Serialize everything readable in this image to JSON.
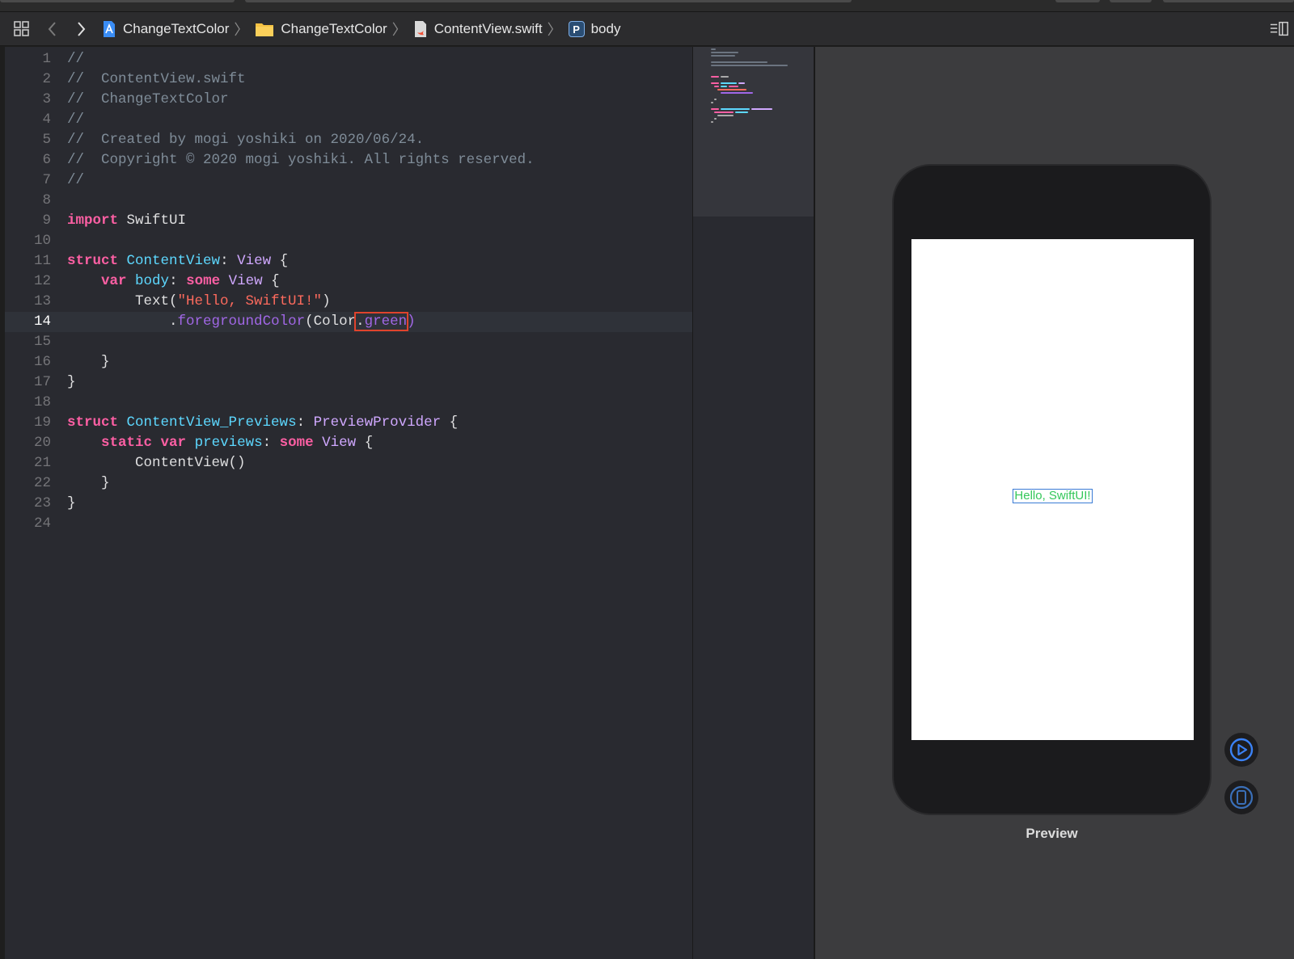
{
  "breadcrumb": {
    "project": "ChangeTextColor",
    "group": "ChangeTextColor",
    "file": "ContentView.swift",
    "symbol_badge": "P",
    "symbol": "body"
  },
  "editor": {
    "current_line": 14,
    "lines": [
      {
        "n": "1"
      },
      {
        "n": "2"
      },
      {
        "n": "3"
      },
      {
        "n": "4"
      },
      {
        "n": "5"
      },
      {
        "n": "6"
      },
      {
        "n": "7"
      },
      {
        "n": "8"
      },
      {
        "n": "9"
      },
      {
        "n": "10"
      },
      {
        "n": "11"
      },
      {
        "n": "12"
      },
      {
        "n": "13"
      },
      {
        "n": "14"
      },
      {
        "n": "15"
      },
      {
        "n": "16"
      },
      {
        "n": "17"
      },
      {
        "n": "18"
      },
      {
        "n": "19"
      },
      {
        "n": "20"
      },
      {
        "n": "21"
      },
      {
        "n": "22"
      },
      {
        "n": "23"
      },
      {
        "n": "24"
      }
    ],
    "t": {
      "c1": "//",
      "c2": "//  ContentView.swift",
      "c3": "//  ChangeTextColor",
      "c4": "//",
      "c5": "//  Created by mogi yoshiki on 2020/06/24.",
      "c6": "//  Copyright © 2020 mogi yoshiki. All rights reserved.",
      "c7": "//",
      "kw_import": "import",
      "mod": "SwiftUI",
      "kw_struct": "struct",
      "t_cv": "ContentView",
      "colon": ":",
      "t_view": "View",
      "brace_open": "{",
      "brace_close": "}",
      "kw_var": "var",
      "p_body": "body",
      "kw_some": "some",
      "text_call": "Text(",
      "str": "\"Hello, SwiftUI!\"",
      "paren_close": ")",
      "dot": ".",
      "fg": "foregroundColor",
      "color_call": "(Color",
      "green": "green",
      "t_cvp": "ContentView_Previews",
      "t_pp": "PreviewProvider",
      "kw_static": "static",
      "p_previews": "previews",
      "cv_call": "ContentView()"
    }
  },
  "preview": {
    "hello_text": "Hello, SwiftUI!",
    "label": "Preview"
  },
  "colors": {
    "editor_bg": "#292a30",
    "keyword": "#fc5fa3",
    "type": "#5dd8ff",
    "string": "#fc6a5d",
    "comment": "#7f8c98",
    "highlight_box": "#e0432c",
    "preview_text": "#34c759"
  },
  "icons": [
    "grid-icon",
    "back-chevron-icon",
    "forward-chevron-icon",
    "project-file-icon",
    "folder-icon",
    "swift-file-icon",
    "property-badge-icon",
    "inspector-toggle-icon",
    "live-preview-play-icon",
    "preview-device-icon"
  ]
}
